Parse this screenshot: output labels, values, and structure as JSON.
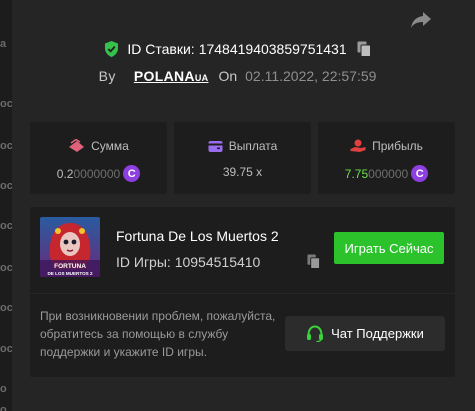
{
  "left_strip": {
    "marks": [
      "a",
      "oc",
      "oc",
      "oc",
      "oc",
      "oc",
      "oc",
      "oc",
      "o",
      "o"
    ]
  },
  "bet": {
    "id_label": "ID Ставки:",
    "id_value": "1748419403859751431",
    "by_label": "By",
    "username": "POLANA",
    "username_suffix": "UA",
    "on_label": "On",
    "date": "02.11.2022, 22:57:59"
  },
  "stats": {
    "amount": {
      "label": "Сумма",
      "value_main": "0.2",
      "value_dim": "0000000",
      "coin": "C"
    },
    "payout": {
      "label": "Выплата",
      "value": "39.75 x"
    },
    "profit": {
      "label": "Прибыль",
      "value_main": "7.75",
      "value_dim": "000000",
      "coin": "C"
    }
  },
  "game": {
    "title": "Fortuna De Los Muertos 2",
    "id_label": "ID Игры:",
    "id_value": "10954515410",
    "thumb_text_1": "FORTUNA",
    "thumb_text_2": "DE LOS MUERTOS 2",
    "play_label": "Играть Сейчас"
  },
  "support": {
    "text": "При возникновении проблем, пожалуйста, обратитесь за помощью в службу поддержки и укажите ID игры.",
    "button_label": "Чат Поддержки"
  },
  "colors": {
    "background": "#252525",
    "panel": "#1d1d1d",
    "accent_green": "#2cc22c",
    "profit_green": "#6ee04a",
    "coin_purple": "#8e3fe0",
    "amount_icon": "#e0627a",
    "payout_icon": "#9a6cf0",
    "profit_icon": "#e04040",
    "shield": "#35c24a"
  },
  "icons": [
    "share-icon",
    "shield-icon",
    "copy-icon",
    "amount-icon",
    "wallet-icon",
    "profit-icon",
    "headset-icon"
  ]
}
